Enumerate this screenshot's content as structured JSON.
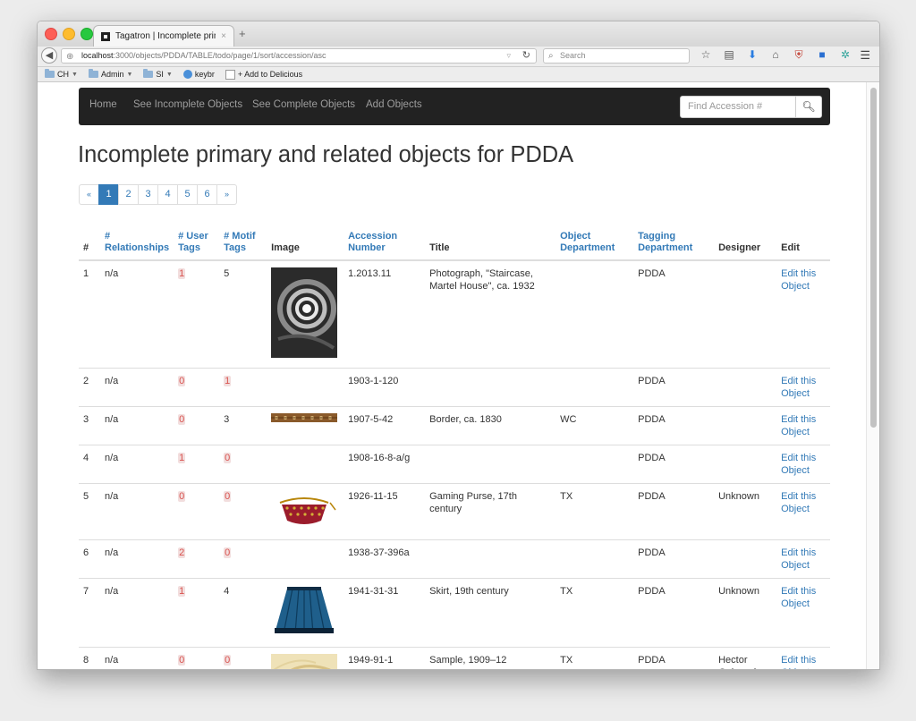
{
  "browser": {
    "tab_title": "Tagatron | Incomplete prim…",
    "tab_close": "×",
    "new_tab": "+",
    "url_host": "localhost",
    "url_path": ":3000/objects/PDDA/TABLE/todo/page/1/sort/accession/asc",
    "search_placeholder": "Search",
    "bookmarks": [
      {
        "label": "CH",
        "type": "folder"
      },
      {
        "label": "Admin",
        "type": "folder"
      },
      {
        "label": "SI",
        "type": "folder"
      },
      {
        "label": "keybr",
        "type": "site"
      },
      {
        "label": "+ Add to Delicious",
        "type": "check"
      }
    ]
  },
  "nav": {
    "links": [
      "Home",
      "See Incomplete Objects",
      "See Complete Objects",
      "Add Objects"
    ],
    "find_placeholder": "Find Accession #"
  },
  "page": {
    "title": "Incomplete primary and related objects for PDDA"
  },
  "pagination": {
    "prev": "«",
    "pages": [
      "1",
      "2",
      "3",
      "4",
      "5",
      "6"
    ],
    "active": "1",
    "next": "»"
  },
  "table": {
    "headers": [
      {
        "label": "#",
        "link": false
      },
      {
        "label": "# Relationships",
        "link": true
      },
      {
        "label": "# User Tags",
        "link": true
      },
      {
        "label": "# Motif Tags",
        "link": true
      },
      {
        "label": "Image",
        "link": false
      },
      {
        "label": "Accession Number",
        "link": true
      },
      {
        "label": "Title",
        "link": false
      },
      {
        "label": "Object Department",
        "link": true
      },
      {
        "label": "Tagging Department",
        "link": true
      },
      {
        "label": "Designer",
        "link": false
      },
      {
        "label": "Edit",
        "link": false
      }
    ],
    "rows": [
      {
        "num": "1",
        "rel": "n/a",
        "user_tags": "1",
        "user_red": true,
        "motif_tags": "5",
        "motif_red": false,
        "image": "staircase",
        "accession": "1.2013.11",
        "title": "Photograph, \"Staircase, Martel House\", ca. 1932",
        "obj_dept": "",
        "tag_dept": "PDDA",
        "designer": "",
        "edit": "Edit this Object"
      },
      {
        "num": "2",
        "rel": "n/a",
        "user_tags": "0",
        "user_red": true,
        "motif_tags": "1",
        "motif_red": true,
        "image": "",
        "accession": "1903-1-120",
        "title": "",
        "obj_dept": "",
        "tag_dept": "PDDA",
        "designer": "",
        "edit": "Edit this Object"
      },
      {
        "num": "3",
        "rel": "n/a",
        "user_tags": "0",
        "user_red": true,
        "motif_tags": "3",
        "motif_red": false,
        "image": "border",
        "accession": "1907-5-42",
        "title": "Border, ca. 1830",
        "obj_dept": "WC",
        "tag_dept": "PDDA",
        "designer": "",
        "edit": "Edit this Object"
      },
      {
        "num": "4",
        "rel": "n/a",
        "user_tags": "1",
        "user_red": true,
        "motif_tags": "0",
        "motif_red": true,
        "image": "",
        "accession": "1908-16-8-a/g",
        "title": "",
        "obj_dept": "",
        "tag_dept": "PDDA",
        "designer": "",
        "edit": "Edit this Object"
      },
      {
        "num": "5",
        "rel": "n/a",
        "user_tags": "0",
        "user_red": true,
        "motif_tags": "0",
        "motif_red": true,
        "image": "purse",
        "accession": "1926-11-15",
        "title": "Gaming Purse, 17th century",
        "obj_dept": "TX",
        "tag_dept": "PDDA",
        "designer": "Unknown",
        "edit": "Edit this Object"
      },
      {
        "num": "6",
        "rel": "n/a",
        "user_tags": "2",
        "user_red": true,
        "motif_tags": "0",
        "motif_red": true,
        "image": "",
        "accession": "1938-37-396a",
        "title": "",
        "obj_dept": "",
        "tag_dept": "PDDA",
        "designer": "",
        "edit": "Edit this Object"
      },
      {
        "num": "7",
        "rel": "n/a",
        "user_tags": "1",
        "user_red": true,
        "motif_tags": "4",
        "motif_red": false,
        "image": "skirt",
        "accession": "1941-31-31",
        "title": "Skirt, 19th century",
        "obj_dept": "TX",
        "tag_dept": "PDDA",
        "designer": "Unknown",
        "edit": "Edit this Object"
      },
      {
        "num": "8",
        "rel": "n/a",
        "user_tags": "0",
        "user_red": true,
        "motif_tags": "0",
        "motif_red": true,
        "image": "sample",
        "accession": "1949-91-1",
        "title": "Sample, 1909–12",
        "obj_dept": "TX",
        "tag_dept": "PDDA",
        "designer": "Hector Guimard",
        "edit": "Edit this Object"
      }
    ]
  },
  "colors": {
    "link": "#337ab7",
    "navbar_bg": "#222222",
    "badge_red_text": "#d9534f",
    "badge_red_bg": "#f2dede"
  }
}
